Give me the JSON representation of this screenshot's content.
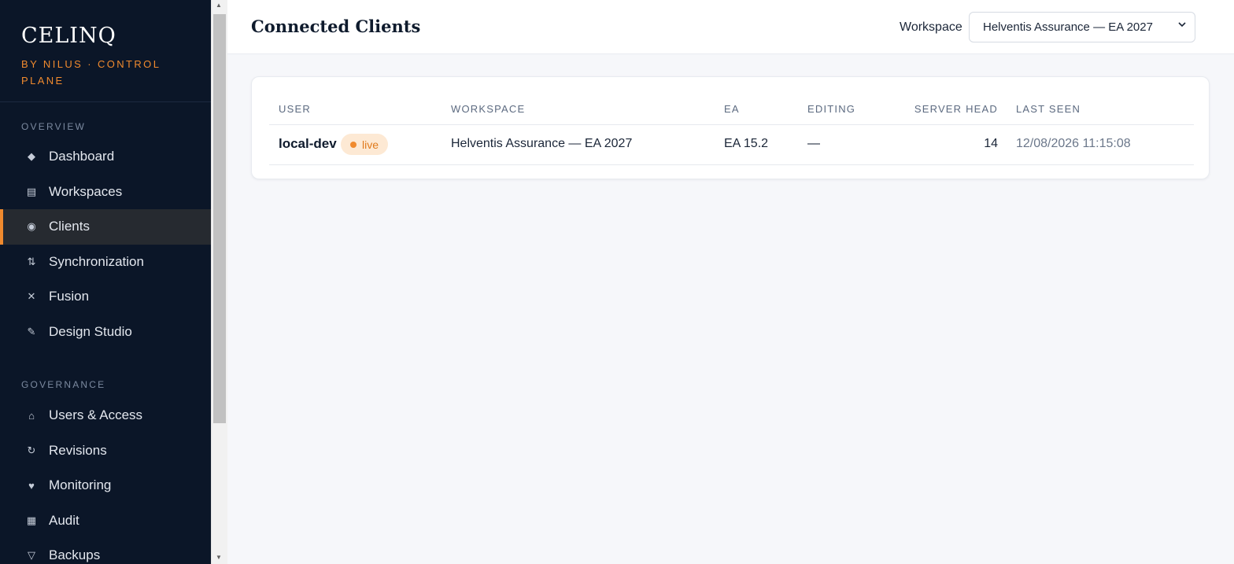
{
  "brand": {
    "title": "CELINQ",
    "subtitle": "BY NILUS · CONTROL PLANE"
  },
  "sidebar": {
    "sections": [
      {
        "label": "OVERVIEW"
      },
      {
        "label": "GOVERNANCE"
      }
    ],
    "overview_items": [
      {
        "label": "Dashboard",
        "icon": "◆"
      },
      {
        "label": "Workspaces",
        "icon": "▤"
      },
      {
        "label": "Clients",
        "icon": "◉",
        "active": true
      },
      {
        "label": "Synchronization",
        "icon": "⇅"
      },
      {
        "label": "Fusion",
        "icon": "✕"
      },
      {
        "label": "Design Studio",
        "icon": "✎"
      }
    ],
    "governance_items": [
      {
        "label": "Users & Access",
        "icon": "⌂"
      },
      {
        "label": "Revisions",
        "icon": "↻"
      },
      {
        "label": "Monitoring",
        "icon": "♥"
      },
      {
        "label": "Audit",
        "icon": "▦"
      },
      {
        "label": "Backups",
        "icon": "▽"
      }
    ]
  },
  "header": {
    "title": "Connected Clients",
    "workspace_label": "Workspace",
    "workspace_selected": "Helventis Assurance — EA 2027"
  },
  "table": {
    "columns": [
      "USER",
      "WORKSPACE",
      "EA",
      "EDITING",
      "SERVER HEAD",
      "LAST SEEN"
    ],
    "rows": [
      {
        "user": "local-dev",
        "status": "live",
        "workspace": "Helventis Assurance — EA 2027",
        "ea": "EA 15.2",
        "editing": "—",
        "server_head": "14",
        "last_seen": "12/08/2026 11:15:08"
      }
    ]
  },
  "colors": {
    "sidebar_bg": "#0b1628",
    "accent": "#f08a2e",
    "badge_bg": "#fde9d4"
  }
}
